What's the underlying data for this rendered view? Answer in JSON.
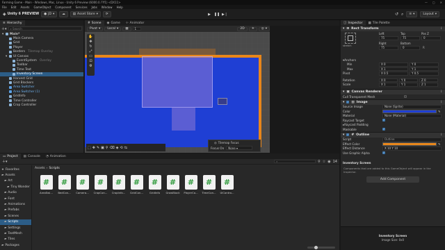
{
  "window": {
    "title": "Farming Game - Main - Windows, Mac, Linux - Unity 6 Preview (6000.0.??f1) <DX11>"
  },
  "menu": [
    "File",
    "Edit",
    "Assets",
    "GameObject",
    "Component",
    "Services",
    "Jobs",
    "Window",
    "Help"
  ],
  "toolbar": {
    "brand": "Unity 6 PREVIEW",
    "account": "JD",
    "asset_store": "Asset Store",
    "layout": "Layout",
    "pivot": "Pivot",
    "local": "Local",
    "page": "1"
  },
  "hierarchy": {
    "tab": "Hierarchy",
    "search_placeholder": "Search",
    "items": [
      {
        "label": "Main*",
        "hint": ""
      },
      {
        "label": "Main Camera",
        "hint": ""
      },
      {
        "label": "Grid",
        "hint": ""
      },
      {
        "label": "Player",
        "hint": ""
      },
      {
        "label": "Borders",
        "hint": "Tilemap Overlay"
      },
      {
        "label": "UI Canvas",
        "hint": ""
      },
      {
        "label": "EventSystem",
        "hint": "Overlay"
      },
      {
        "label": "Toolbar",
        "hint": ""
      },
      {
        "label": "Time Text",
        "hint": ""
      },
      {
        "label": "Inventory Screen",
        "hint": ""
      },
      {
        "label": "Harvest Grid",
        "hint": ""
      },
      {
        "label": "Grid Blockers",
        "hint": ""
      },
      {
        "label": "Area Switcher",
        "hint": ""
      },
      {
        "label": "Area Switcher (1)",
        "hint": ""
      },
      {
        "label": "GridInfo",
        "hint": ""
      },
      {
        "label": "Time Controller",
        "hint": ""
      },
      {
        "label": "Crop Controller",
        "hint": ""
      }
    ]
  },
  "scene": {
    "tabs": [
      "Scene",
      "Game",
      "Animator"
    ],
    "overlay": {
      "title": "Tilemap Focus",
      "focus_label": "Focus On",
      "focus_value": "None"
    },
    "colors": {
      "canvas": "#1f3fd4",
      "border": "#e8861a",
      "background": "#4a4a4a"
    }
  },
  "inspector": {
    "tabs": [
      "Inspector",
      "Tile Palette"
    ],
    "rect_transform": {
      "title": "Rect Transform",
      "stretch": "stretch",
      "labels": {
        "left": "Left",
        "top": "Top",
        "pos_z": "Pos Z",
        "right": "Right",
        "bottom": "Bottom"
      },
      "values": {
        "left": "75",
        "top": "75",
        "pos_z": "0",
        "right": "75",
        "bottom": "0"
      },
      "anchors": "Anchors",
      "min": "Min",
      "max": "Max",
      "pivot": "Pivot",
      "min_x": "0",
      "min_y": "0",
      "max_x": "1",
      "max_y": "1",
      "pivot_x": "0.5",
      "pivot_y": "0.5",
      "rotation": "Rotation",
      "scale": "Scale",
      "rot_x": "0",
      "rot_y": "0",
      "rot_z": "0",
      "scale_x": "1",
      "scale_y": "1",
      "scale_z": "1"
    },
    "canvas_renderer": {
      "title": "Canvas Renderer",
      "cull": "Cull Transparent Mesh"
    },
    "image": {
      "title": "Image",
      "rows": [
        {
          "label": "Source Image",
          "value": "None (Sprite)"
        },
        {
          "label": "Color",
          "value": ""
        },
        {
          "label": "Material",
          "value": "None (Material)"
        },
        {
          "label": "Raycast Target",
          "value": ""
        },
        {
          "label": "Raycast Padding",
          "value": ""
        },
        {
          "label": "Maskable",
          "value": ""
        }
      ],
      "color": "#1f3fd4"
    },
    "outline": {
      "title": "Outline",
      "rows": [
        {
          "label": "Script",
          "value": "Outline"
        },
        {
          "label": "Effect Color",
          "value": ""
        },
        {
          "label": "Effect Distance",
          "value": "X 10   Y 10"
        },
        {
          "label": "Use Graphic Alpha",
          "value": ""
        }
      ],
      "color": "#e8861a"
    },
    "footer_name": "Inventory Screen",
    "footer_note": "Components that are added to this GameObject will appear in the Inspector.",
    "add_component": "Add Component",
    "preview_title": "Inventory Screen",
    "preview_size": "Image Size: 0x0"
  },
  "project": {
    "tabs": [
      "Project",
      "Console",
      "Animation"
    ],
    "breadcrumb": [
      "Assets",
      "Scripts"
    ],
    "tree": [
      "Favorites",
      "Assets",
      "Art",
      "Tiny Wonder",
      "Audio",
      "Font",
      "Animations",
      "Prefabs",
      "Scenes",
      "Scripts",
      "Settings",
      "TextMesh",
      "Tiles",
      "Packages"
    ],
    "files": [
      "AreaSwi...",
      "BedCon...",
      "Camera...",
      "CropCon...",
      "CropInfo...",
      "GridCon...",
      "GridInfo",
      "GrowBlock",
      "PlayerCo...",
      "TimeCon...",
      "UIContro..."
    ],
    "count": "14"
  }
}
